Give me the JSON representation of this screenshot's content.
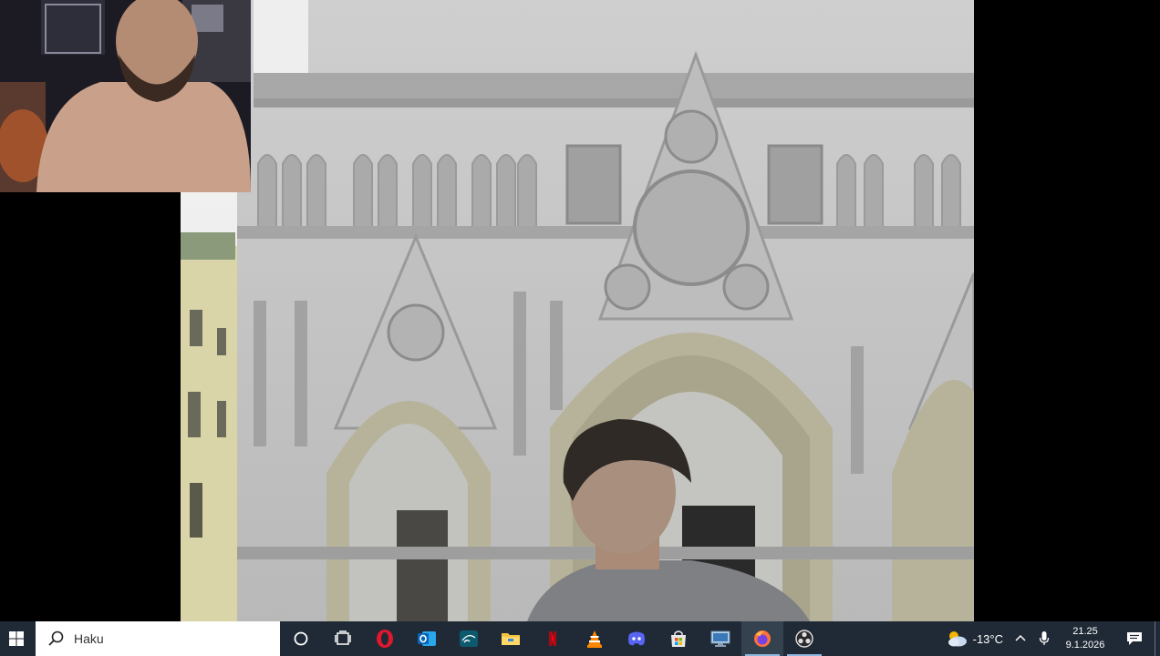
{
  "taskbar": {
    "start_icon": "windows-logo-icon",
    "search": {
      "icon": "search-icon",
      "placeholder": "Haku"
    },
    "pinned": [
      {
        "name": "cortana-icon"
      },
      {
        "name": "task-view-icon"
      },
      {
        "name": "opera-icon"
      },
      {
        "name": "outlook-icon"
      },
      {
        "name": "disney-plus-icon"
      },
      {
        "name": "file-explorer-icon"
      },
      {
        "name": "netflix-icon"
      },
      {
        "name": "vlc-icon"
      },
      {
        "name": "discord-icon"
      },
      {
        "name": "microsoft-store-icon"
      },
      {
        "name": "remote-desktop-icon"
      },
      {
        "name": "firefox-icon"
      },
      {
        "name": "obs-studio-icon"
      }
    ],
    "active_app": "firefox-icon",
    "weather": {
      "icon": "cloud-sun-icon",
      "temperature": "-13°C"
    },
    "tray_icons": [
      "chevron-up-icon",
      "microphone-icon"
    ],
    "clock": {
      "time": "21.25",
      "date": "9.1.2026"
    },
    "notification_icon": "notification-icon"
  },
  "colors": {
    "taskbar_bg": "#1f2a36",
    "active_indicator": "#8fb8e0",
    "search_bg": "#ffffff"
  }
}
